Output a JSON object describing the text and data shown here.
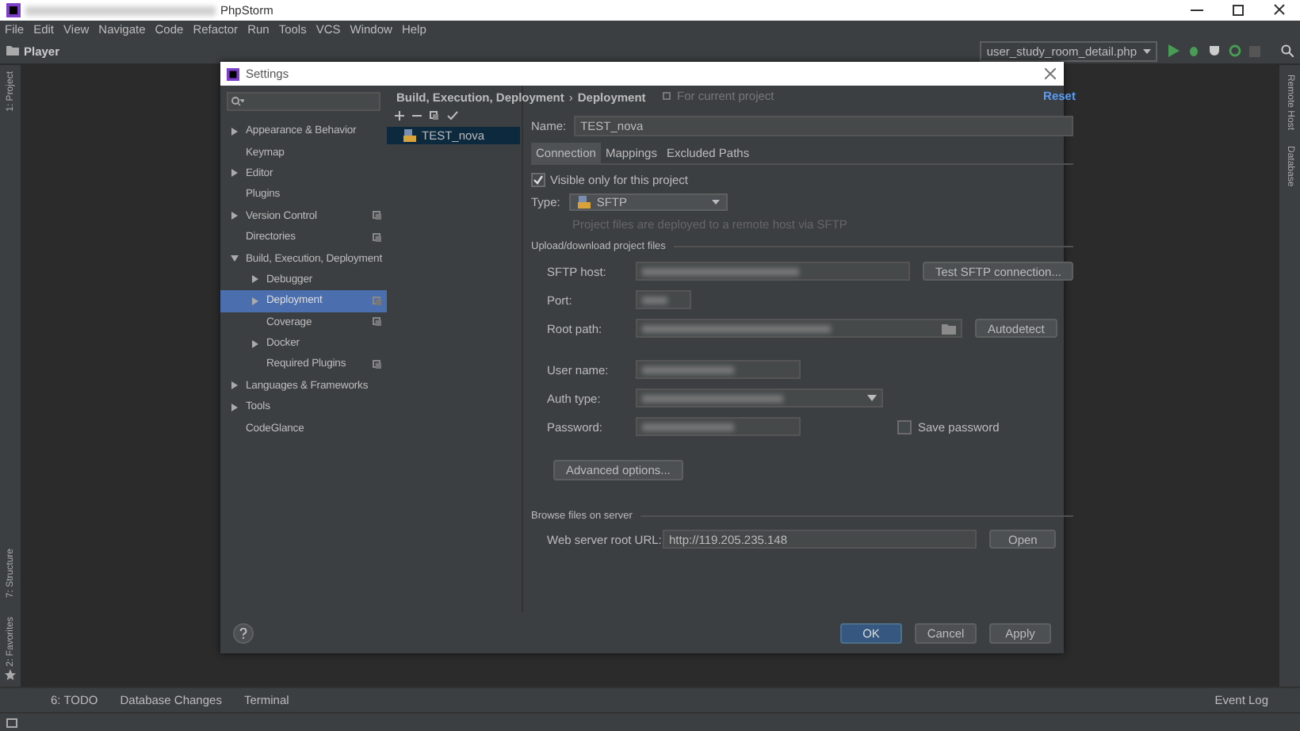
{
  "window": {
    "title": "PhpStorm"
  },
  "menu": [
    "File",
    "Edit",
    "View",
    "Navigate",
    "Code",
    "Refactor",
    "Run",
    "Tools",
    "VCS",
    "Window",
    "Help"
  ],
  "navbar": {
    "breadcrumb": "Player",
    "run_config": "user_study_room_detail.php"
  },
  "left_stripe": [
    "1: Project",
    "7: Structure",
    "2: Favorites"
  ],
  "right_stripe": [
    "Remote Host",
    "Database"
  ],
  "dialog": {
    "title": "Settings",
    "tree": [
      {
        "label": "Appearance & Behavior",
        "kind": "folder",
        "expanded": false,
        "selected": false,
        "scoped": false
      },
      {
        "label": "Keymap",
        "kind": "page",
        "selected": false,
        "scoped": false
      },
      {
        "label": "Editor",
        "kind": "folder",
        "expanded": false,
        "selected": false,
        "scoped": false
      },
      {
        "label": "Plugins",
        "kind": "page",
        "selected": false,
        "scoped": false
      },
      {
        "label": "Version Control",
        "kind": "folder",
        "expanded": false,
        "selected": false,
        "scoped": true
      },
      {
        "label": "Directories",
        "kind": "page",
        "selected": false,
        "scoped": true
      },
      {
        "label": "Build, Execution, Deployment",
        "kind": "folder",
        "expanded": true,
        "selected": false,
        "scoped": false,
        "children": [
          {
            "label": "Debugger",
            "kind": "folder",
            "expanded": false,
            "selected": false,
            "scoped": false
          },
          {
            "label": "Deployment",
            "kind": "folder",
            "expanded": false,
            "selected": true,
            "scoped": true
          },
          {
            "label": "Coverage",
            "kind": "page",
            "selected": false,
            "scoped": true
          },
          {
            "label": "Docker",
            "kind": "folder",
            "expanded": false,
            "selected": false,
            "scoped": false
          },
          {
            "label": "Required Plugins",
            "kind": "page",
            "selected": false,
            "scoped": true
          }
        ]
      },
      {
        "label": "Languages & Frameworks",
        "kind": "folder",
        "expanded": false,
        "selected": false,
        "scoped": false
      },
      {
        "label": "Tools",
        "kind": "folder",
        "expanded": false,
        "selected": false,
        "scoped": false
      },
      {
        "label": "CodeGlance",
        "kind": "page",
        "selected": false,
        "scoped": false
      }
    ],
    "breadcrumb": [
      "Build, Execution, Deployment",
      "Deployment"
    ],
    "breadcrumb_separator": "›",
    "scope_note": "For current project",
    "reset": "Reset",
    "servers": [
      {
        "name": "TEST_nova",
        "selected": true
      }
    ],
    "name": {
      "label": "Name:",
      "value": "TEST_nova"
    },
    "tabs": [
      {
        "label": "Connection",
        "selected": true
      },
      {
        "label": "Mappings",
        "selected": false
      },
      {
        "label": "Excluded Paths",
        "selected": false
      }
    ],
    "visible_only": {
      "label": "Visible only for this project",
      "checked": true
    },
    "type": {
      "label": "Type:",
      "value": "SFTP"
    },
    "type_hint": "Project files are deployed to a remote host via SFTP",
    "section_upload": "Upload/download project files",
    "fields": [
      {
        "label": "SFTP host:",
        "kind": "text",
        "button": "Test SFTP connection..."
      },
      {
        "label": "Port:",
        "kind": "short"
      },
      {
        "label": "Root path:",
        "kind": "browse",
        "button": "Autodetect"
      },
      {
        "label": "User name:",
        "kind": "medium"
      },
      {
        "label": "Auth type:",
        "kind": "dropdown"
      },
      {
        "label": "Password:",
        "kind": "medium",
        "checkbox": {
          "label": "Save password",
          "checked": false
        }
      }
    ],
    "advanced": "Advanced options...",
    "section_browse": "Browse files on server",
    "web_url": {
      "label": "Web server root URL:",
      "value": "http://119.205.235.148",
      "button": "Open"
    },
    "footer_buttons": [
      {
        "label": "OK",
        "default": true
      },
      {
        "label": "Cancel",
        "default": false
      },
      {
        "label": "Apply",
        "default": false
      }
    ]
  },
  "bottom_tabs": [
    "6: TODO",
    "Database Changes",
    "Terminal"
  ],
  "event_log": "Event Log"
}
